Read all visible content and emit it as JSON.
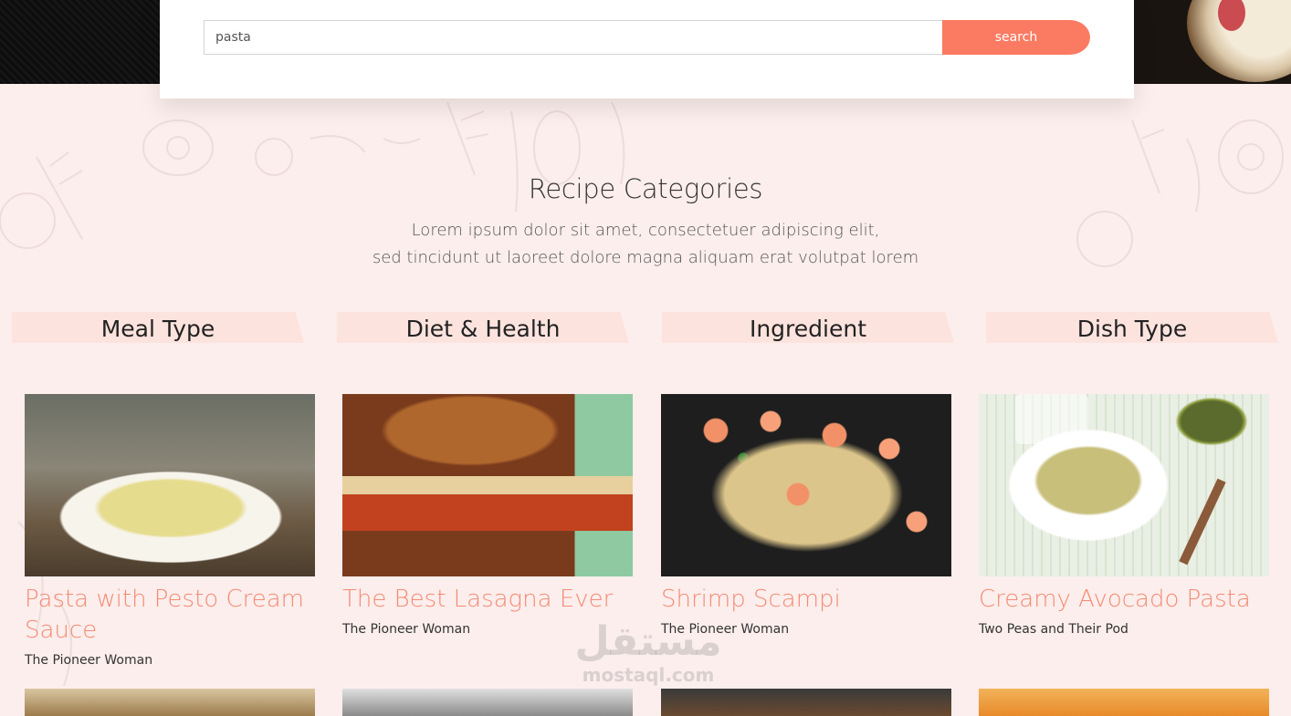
{
  "search": {
    "value": "pasta",
    "button_label": "search"
  },
  "section": {
    "title": "Recipe Categories",
    "subtitle_line1": "Lorem ipsum dolor sit amet, consectetuer adipiscing elit,",
    "subtitle_line2": "sed tincidunt ut laoreet dolore magna aliquam erat volutpat lorem"
  },
  "categories": [
    {
      "label": "Meal Type"
    },
    {
      "label": "Diet & Health"
    },
    {
      "label": "Ingredient"
    },
    {
      "label": "Dish Type"
    }
  ],
  "recipes": [
    {
      "title": "Pasta with Pesto Cream Sauce",
      "source": "The Pioneer Woman"
    },
    {
      "title": "The Best Lasagna Ever",
      "source": "The Pioneer Woman"
    },
    {
      "title": "Shrimp Scampi",
      "source": "The Pioneer Woman"
    },
    {
      "title": "Creamy Avocado Pasta",
      "source": "Two Peas and Their Pod"
    }
  ],
  "watermark": {
    "arabic": "مستقل",
    "latin": "mostaql.com"
  },
  "colors": {
    "accent": "#fa7b62",
    "recipe_title": "#f58a74",
    "tab_bg": "#fde3de",
    "page_bg": "#fbeeec"
  }
}
